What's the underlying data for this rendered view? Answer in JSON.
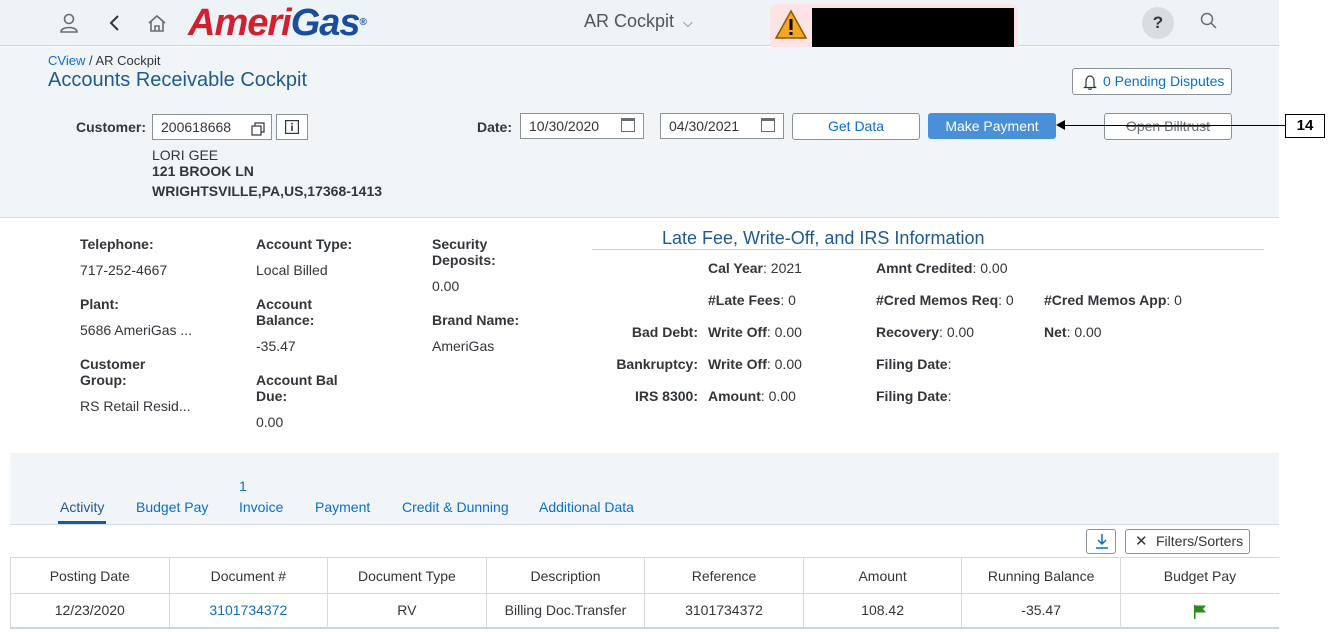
{
  "shell": {
    "logo_ameri": "Ameri",
    "logo_gas": "Gas",
    "logo_reg": "®",
    "app_title": "AR Cockpit",
    "help_label": "?"
  },
  "header": {
    "breadcrumb_link": "CView",
    "breadcrumb_sep": " / ",
    "breadcrumb_current": "AR Cockpit",
    "page_title": "Accounts Receivable Cockpit",
    "pending_disputes": "0 Pending Disputes",
    "customer_label": "Customer:",
    "customer_value": "200618668",
    "date_label": "Date:",
    "date_from": "10/30/2020",
    "date_to": "04/30/2021",
    "get_data": "Get Data",
    "make_payment": "Make Payment",
    "open_billtrust": "Open Billtrust",
    "customer_name": "LORI GEE",
    "address_line1": "121 BROOK LN",
    "address_line2": "WRIGHTSVILLE,PA,US,17368-1413"
  },
  "callout": {
    "number": "14"
  },
  "details": {
    "telephone_label": "Telephone:",
    "telephone": "717-252-4667",
    "plant_label": "Plant:",
    "plant": "5686 AmeriGas ...",
    "customer_group_label_1": "Customer",
    "customer_group_label_2": "Group:",
    "customer_group": "RS Retail Resid...",
    "account_type_label": "Account Type:",
    "account_type": "Local Billed",
    "account_balance_label_1": "Account",
    "account_balance_label_2": "Balance:",
    "account_balance": "-35.47",
    "account_bal_due_label_1": "Account Bal",
    "account_bal_due_label_2": "Due:",
    "account_bal_due": "0.00",
    "security_deposits_label_1": "Security",
    "security_deposits_label_2": "Deposits:",
    "security_deposits": "0.00",
    "brand_name_label": "Brand Name:",
    "brand_name": "AmeriGas"
  },
  "late_fee": {
    "title": "Late Fee, Write-Off, and IRS Information",
    "cal_year_label": "Cal Year",
    "cal_year": ": 2021",
    "amnt_credited_label": "Amnt Credited",
    "amnt_credited": ": 0.00",
    "late_fees_label": "#Late Fees",
    "late_fees": ": 0",
    "cred_memos_req_label": "#Cred Memos Req",
    "cred_memos_req": ": 0",
    "cred_memos_app_label": "#Cred Memos App",
    "cred_memos_app": ": 0",
    "bad_debt_label": "Bad Debt:",
    "bad_debt_writeoff_label": "Write Off",
    "bad_debt_writeoff": ": 0.00",
    "recovery_label": "Recovery",
    "recovery": ": 0.00",
    "net_label": "Net",
    "net": ": 0.00",
    "bankruptcy_label": "Bankruptcy:",
    "bankruptcy_writeoff_label": "Write Off",
    "bankruptcy_writeoff": ": 0.00",
    "filing_date_label_1": "Filing Date",
    "filing_date_1": ":",
    "irs_label": "IRS 8300:",
    "irs_amount_label": "Amount",
    "irs_amount": ": 0.00",
    "filing_date_label_2": "Filing Date",
    "filing_date_2": ":"
  },
  "tabs": {
    "items": [
      "Activity",
      "Budget Pay",
      "Invoice",
      "Payment",
      "Credit & Dunning",
      "Additional Data"
    ],
    "invoice_count": "1",
    "active": "Activity"
  },
  "toolbar": {
    "filters_sorters": "Filters/Sorters"
  },
  "table": {
    "headers": [
      "Posting Date",
      "Document #",
      "Document Type",
      "Description",
      "Reference",
      "Amount",
      "Running Balance",
      "Budget Pay"
    ],
    "rows": [
      {
        "posting_date": "12/23/2020",
        "document": "3101734372",
        "document_type": "RV",
        "description": "Billing Doc.Transfer",
        "reference": "3101734372",
        "amount": "108.42",
        "running_balance": "-35.47",
        "budget_pay_icon": "green-flag-icon"
      }
    ]
  },
  "colors": {
    "brand_red": "#d1202f",
    "brand_blue": "#1a4e9c",
    "link": "#0a6ed1",
    "primary_button": "#4a90d9",
    "title_blue": "#1d5a91",
    "flag_green": "#2b8a1f"
  }
}
